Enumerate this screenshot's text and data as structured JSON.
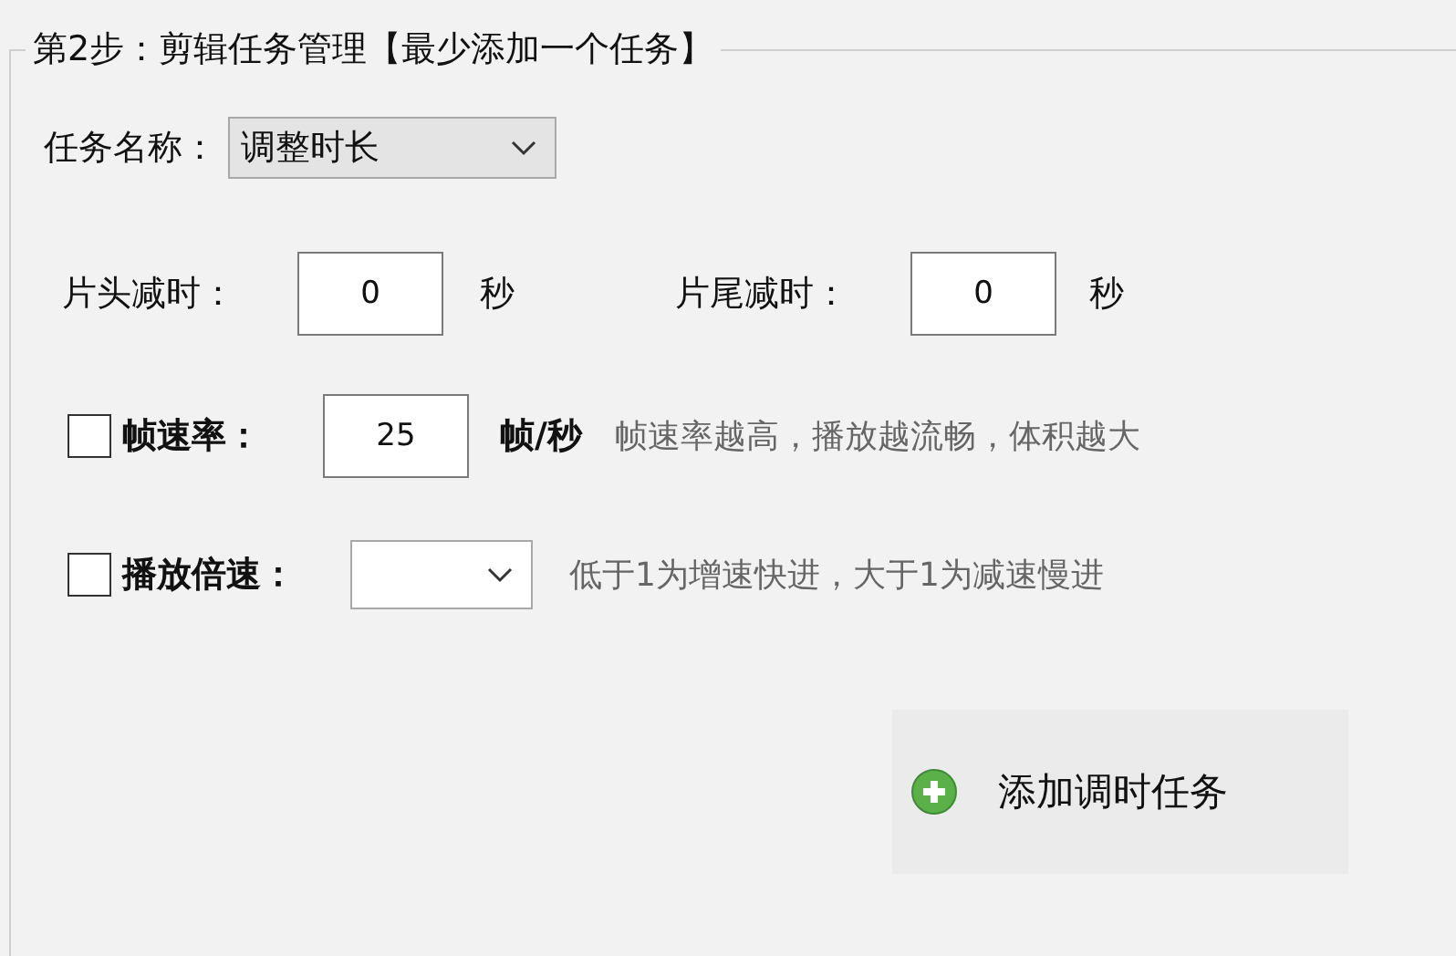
{
  "group": {
    "title": "第2步：剪辑任务管理【最少添加一个任务】"
  },
  "task_name": {
    "label": "任务名称：",
    "value": "调整时长"
  },
  "head_trim": {
    "label": "片头减时：",
    "value": "0",
    "unit": "秒"
  },
  "tail_trim": {
    "label": "片尾减时：",
    "value": "0",
    "unit": "秒"
  },
  "frame_rate": {
    "checked": false,
    "label": "帧速率：",
    "value": "25",
    "unit": "帧/秒",
    "hint": "帧速率越高，播放越流畅，体积越大"
  },
  "playback_speed": {
    "checked": false,
    "label": "播放倍速：",
    "hint": "低于1为增速快进，大于1为减速慢进"
  },
  "add_button": {
    "label": "添加调时任务"
  }
}
